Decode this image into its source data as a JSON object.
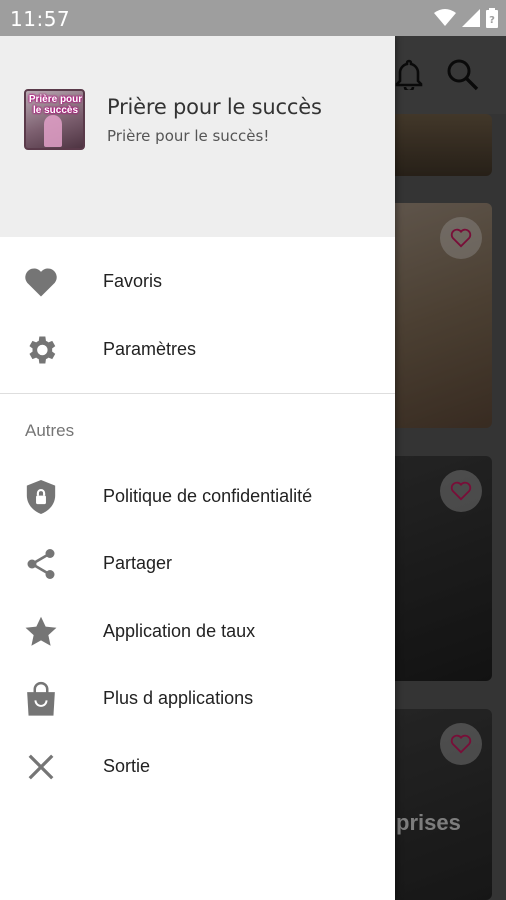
{
  "status_bar": {
    "time": "11:57",
    "icons": [
      "wifi-icon",
      "signal-icon",
      "battery-icon"
    ]
  },
  "drawer": {
    "header": {
      "logo_text": "Prière pour le succès",
      "title": "Prière pour le succès",
      "subtitle": "Prière pour le succès!"
    },
    "items": [
      {
        "label": "Favoris",
        "icon": "heart-icon"
      },
      {
        "label": "Paramètres",
        "icon": "gear-icon"
      }
    ],
    "section_label": "Autres",
    "other_items": [
      {
        "label": "Politique de confidentialité",
        "icon": "shield-lock-icon"
      },
      {
        "label": "Partager",
        "icon": "share-icon"
      },
      {
        "label": "Application de taux",
        "icon": "star-icon"
      },
      {
        "label": "Plus d applications",
        "icon": "shopping-bag-icon"
      },
      {
        "label": "Sortie",
        "icon": "close-icon"
      }
    ]
  },
  "background": {
    "toolbar_icons": [
      "bell-icon",
      "search-icon"
    ],
    "card_title_fragment": "prises"
  },
  "colors": {
    "icon_gray": "#757575",
    "header_bg": "#eeeeee",
    "drawer_bg": "#ffffff",
    "status_bar": "#9e9e9e"
  }
}
